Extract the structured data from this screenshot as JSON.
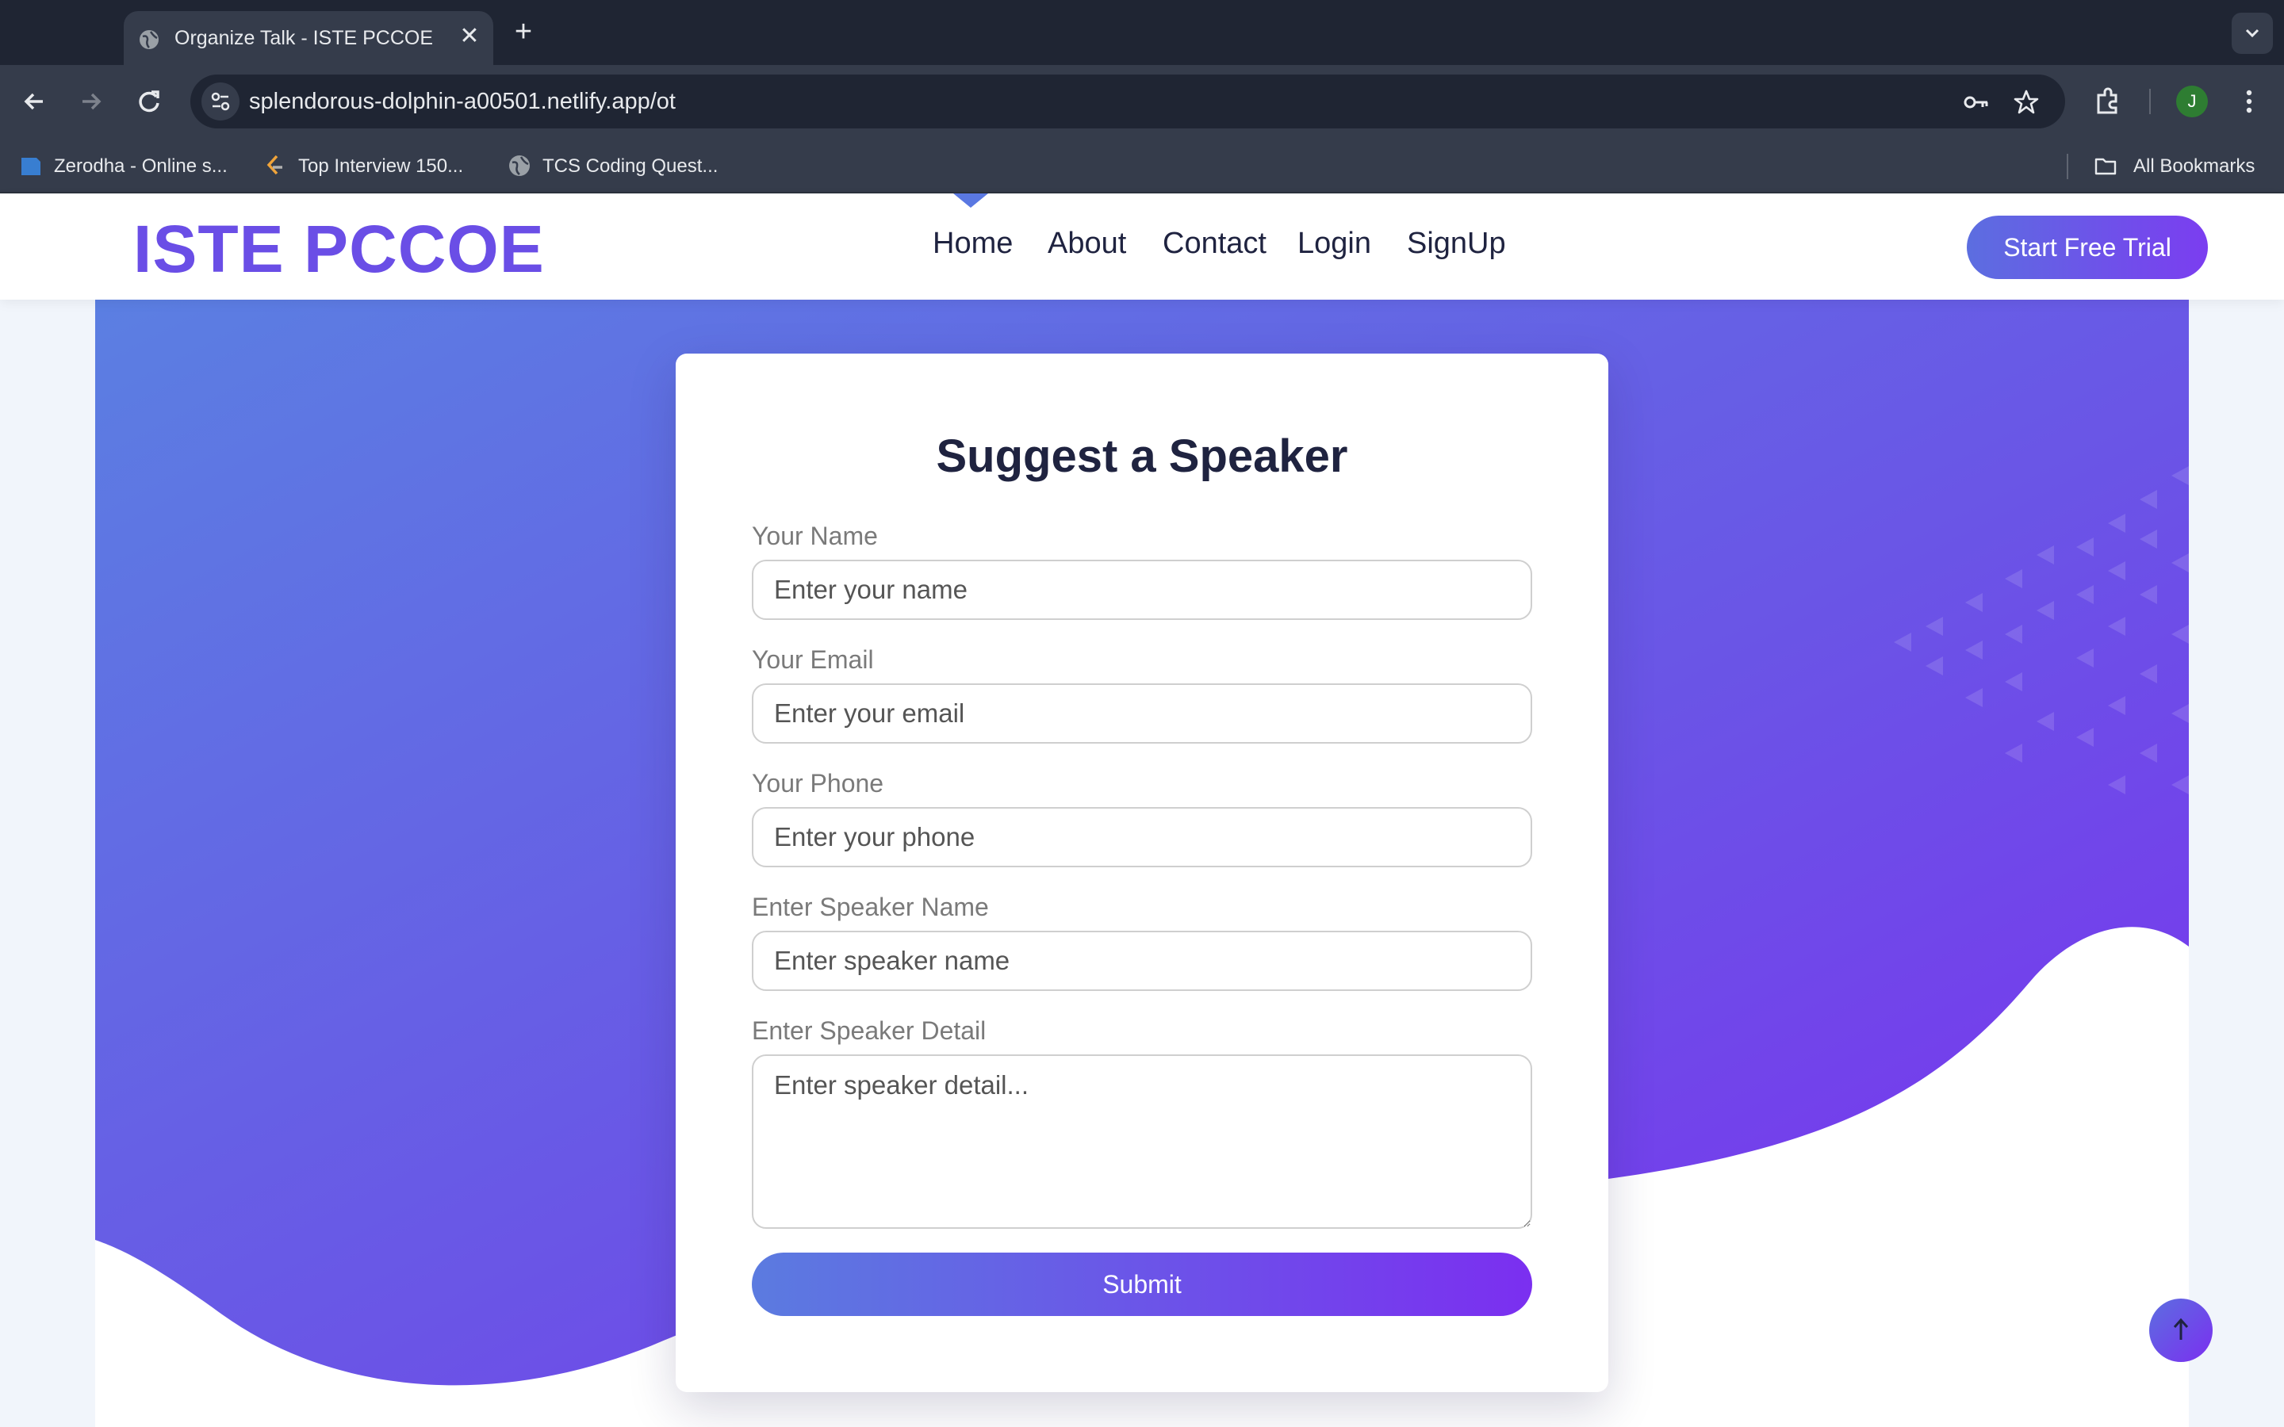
{
  "browser": {
    "tab_title": "Organize Talk - ISTE PCCOE",
    "url": "splendorous-dolphin-a00501.netlify.app/ot",
    "profile_initial": "J",
    "bookmarks": [
      {
        "label": "Zerodha - Online s...",
        "icon": "zerodha-icon"
      },
      {
        "label": "Top Interview 150...",
        "icon": "leetcode-icon"
      },
      {
        "label": "TCS Coding Quest...",
        "icon": "globe-icon"
      }
    ],
    "all_bookmarks_label": "All Bookmarks"
  },
  "header": {
    "logo": "ISTE PCCOE",
    "nav": [
      "Home",
      "About",
      "Contact",
      "Login",
      "SignUp"
    ],
    "cta": "Start Free Trial"
  },
  "form": {
    "title": "Suggest a Speaker",
    "fields": [
      {
        "label": "Your Name",
        "placeholder": "Enter your name"
      },
      {
        "label": "Your Email",
        "placeholder": "Enter your email"
      },
      {
        "label": "Your Phone",
        "placeholder": "Enter your phone"
      },
      {
        "label": "Enter Speaker Name",
        "placeholder": "Enter speaker name"
      },
      {
        "label": "Enter Speaker Detail",
        "placeholder": "Enter speaker detail..."
      }
    ],
    "submit_label": "Submit"
  },
  "colors": {
    "brand_gradient_start": "#5b7be0",
    "brand_gradient_end": "#7b2ff0",
    "logo": "#6a4ee6"
  }
}
